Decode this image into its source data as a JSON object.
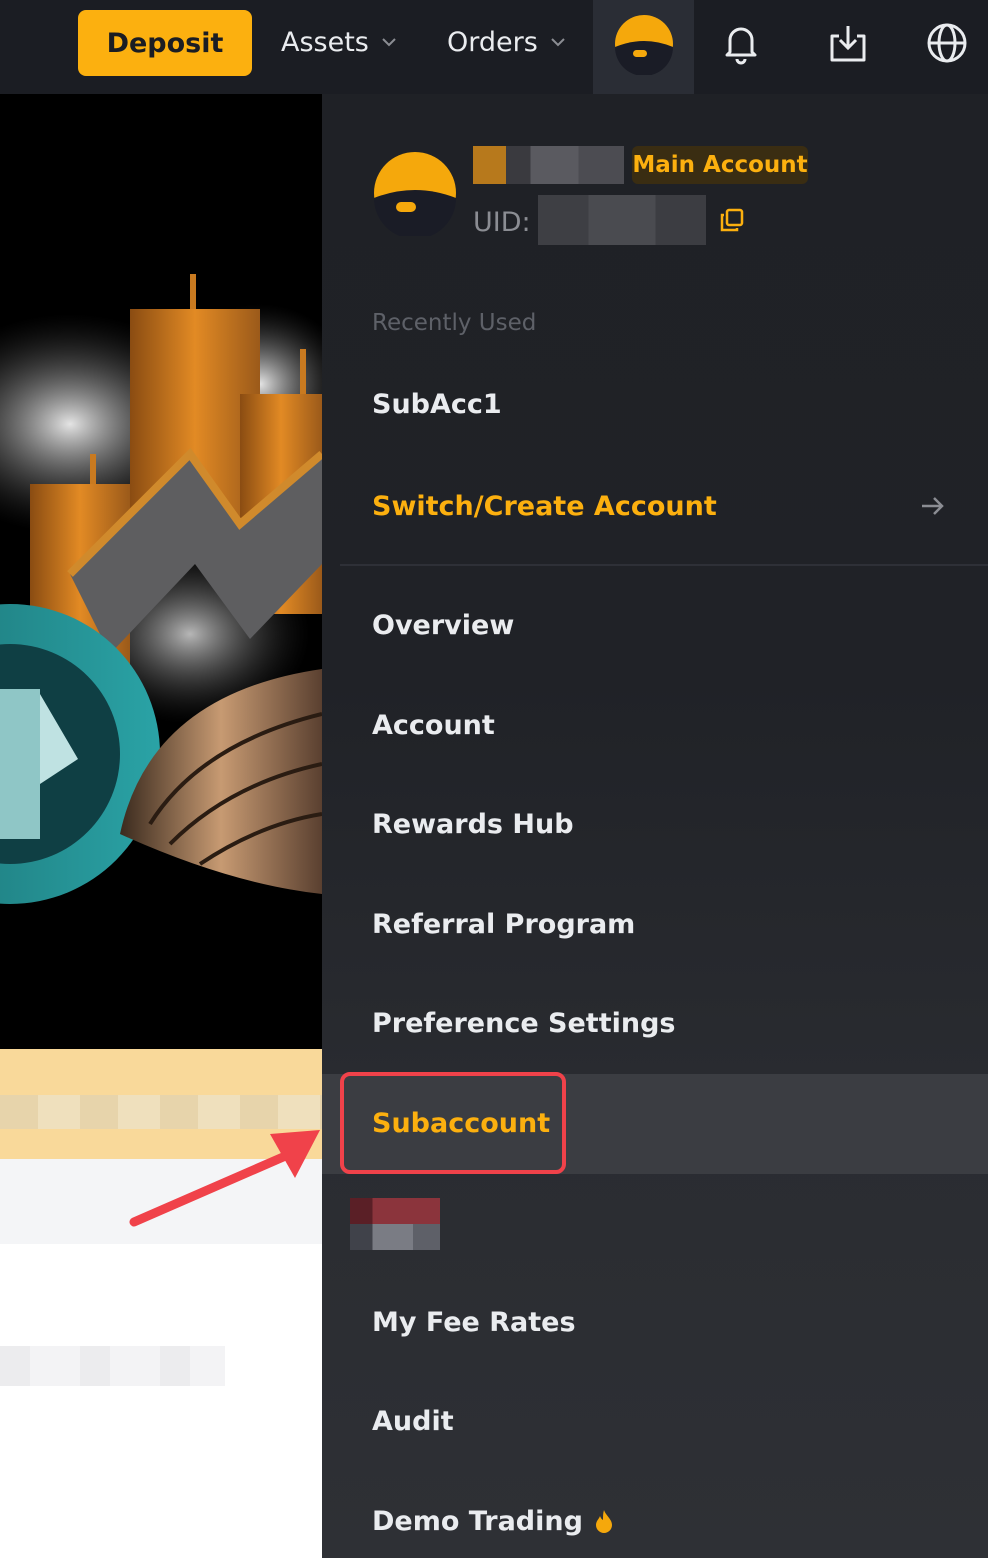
{
  "topbar": {
    "deposit_label": "Deposit",
    "assets_label": "Assets",
    "orders_label": "Orders",
    "icons": [
      "avatar-icon",
      "bell-icon",
      "download-icon",
      "globe-icon"
    ]
  },
  "profile": {
    "badge": "Main Account",
    "uid_label": "UID:"
  },
  "recent": {
    "label": "Recently Used",
    "items": [
      "SubAcc1"
    ]
  },
  "switch_label": "Switch/Create Account",
  "menu": {
    "overview": "Overview",
    "account": "Account",
    "rewards": "Rewards Hub",
    "referral": "Referral Program",
    "preferences": "Preference Settings",
    "subaccount": "Subaccount",
    "fee_rates": "My Fee Rates",
    "audit": "Audit",
    "demo": "Demo Trading"
  },
  "colors": {
    "accent": "#fcb00f",
    "panel_bg": "#1f2126",
    "highlight_border": "#f0424a"
  }
}
